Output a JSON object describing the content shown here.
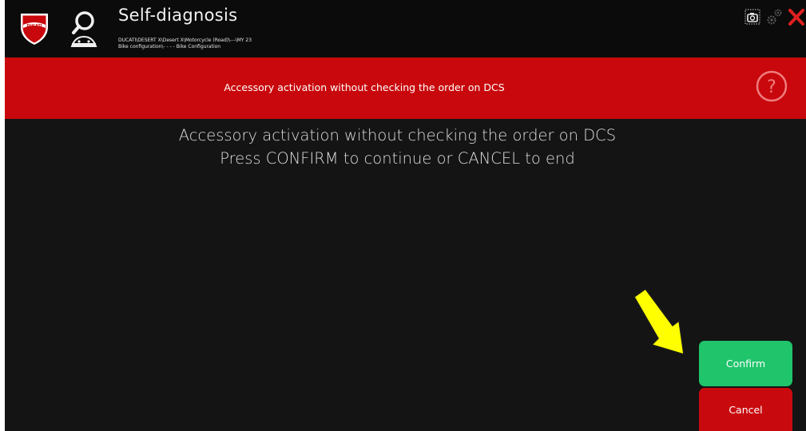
{
  "header": {
    "title": "Self-diagnosis",
    "path_line1": "DUCATI\\DESERT X\\Desert X\\Motorcycle (Road)\\---\\MY 23",
    "path_line2": "Bike configuration\\- - - - Bike Configuration",
    "logo_text": "DUCATI",
    "icons": [
      "ducati-logo",
      "diagnosis-magnifier-icon",
      "screenshot-icon",
      "settings-gears-icon",
      "close-icon"
    ]
  },
  "banner": {
    "text": "Accessory activation without checking the order on DCS",
    "help_icon": "question-mark-icon",
    "help_label": "?"
  },
  "message": {
    "line1": "Accessory activation without checking the order on DCS",
    "line2": "Press CONFIRM to continue or CANCEL to end"
  },
  "actions": {
    "confirm_label": "Confirm",
    "cancel_label": "Cancel"
  },
  "colors": {
    "banner": "#c8080c",
    "confirm": "#1fc46b",
    "cancel": "#c80a0e",
    "background": "#141414",
    "arrow": "#ffff00"
  }
}
